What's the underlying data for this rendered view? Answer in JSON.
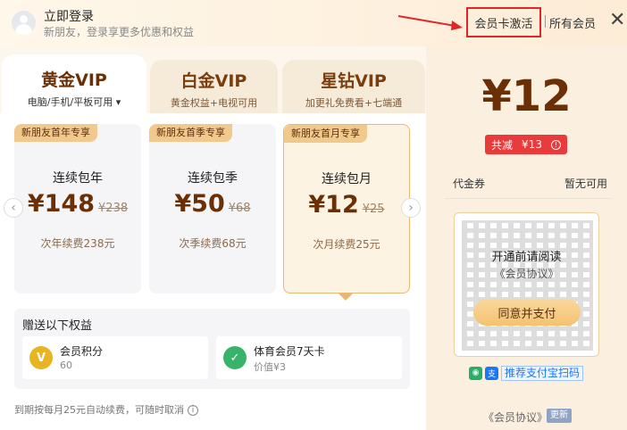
{
  "header": {
    "login_title": "立即登录",
    "login_subtitle": "新朋友，登录享更多优惠和权益",
    "activate_label": "会员卡激活",
    "all_members_label": "所有会员",
    "close_icon": "close-icon",
    "highlight_color": "#e0262d"
  },
  "tabs": [
    {
      "title": "黄金VIP",
      "subtitle": "电脑/手机/平板可用 ▾"
    },
    {
      "title": "白金VIP",
      "subtitle": "黄金权益+电视可用"
    },
    {
      "title": "星钻VIP",
      "subtitle": "加更礼免费看+七端通"
    }
  ],
  "plans": [
    {
      "badge": "新朋友首年专享",
      "name": "连续包年",
      "price": "¥148",
      "original": "¥238",
      "note": "次年续费238元"
    },
    {
      "badge": "新朋友首季专享",
      "name": "连续包季",
      "price": "¥50",
      "original": "¥68",
      "note": "次季续费68元"
    },
    {
      "badge": "新朋友首月专享",
      "name": "连续包月",
      "price": "¥12",
      "original": "¥25",
      "note": "次月续费25元"
    }
  ],
  "gifts": {
    "title": "赠送以下权益",
    "items": [
      {
        "name": "会员积分",
        "value": "60",
        "icon": "V"
      },
      {
        "name": "体育会员7天卡",
        "value": "价值¥3",
        "icon": "✓"
      }
    ]
  },
  "footnote": "到期按每月25元自动续费，可随时取消",
  "payment": {
    "price": "¥12",
    "reduce_label": "共减",
    "reduce_value": "¥13",
    "coupon_label": "代金券",
    "coupon_value": "暂无可用",
    "qr_text1": "开通前请阅读",
    "qr_text2": "《会员协议》",
    "agree_button": "同意并支付",
    "scan_text": "推荐支付宝扫码",
    "agreement_link": "《会员协议》",
    "update_badge": "更新"
  }
}
